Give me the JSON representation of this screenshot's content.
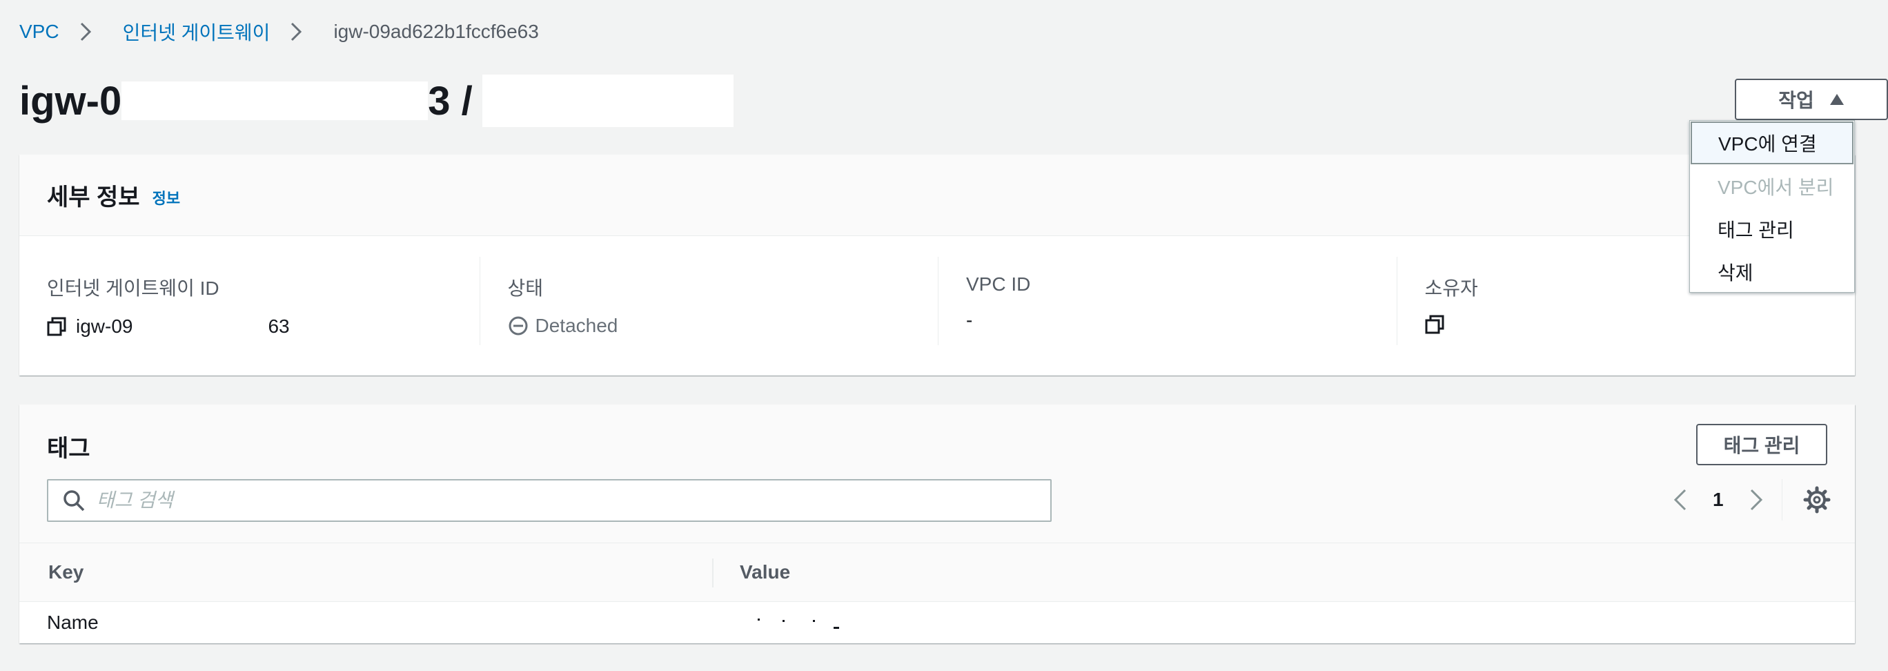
{
  "breadcrumb": {
    "items": [
      {
        "label": "VPC"
      },
      {
        "label": "인터넷 게이트웨이"
      },
      {
        "label": "igw-09ad622b1fccf6e63"
      }
    ]
  },
  "header": {
    "title_prefix": "igw-0",
    "title_suffix": "3 /",
    "actions_label": "작업"
  },
  "actions_menu": {
    "items": [
      {
        "label": "VPC에 연결",
        "state": "highlighted"
      },
      {
        "label": "VPC에서 분리",
        "state": "disabled"
      },
      {
        "label": "태그 관리",
        "state": "enabled"
      },
      {
        "label": "삭제",
        "state": "enabled"
      }
    ]
  },
  "details": {
    "title": "세부 정보",
    "info_link": "정보",
    "fields": [
      {
        "label": "인터넷 게이트웨이 ID",
        "value_prefix": "igw-09",
        "value_suffix": "63",
        "icon": "copy-icon"
      },
      {
        "label": "상태",
        "value": "Detached",
        "icon": "minus-circle-icon"
      },
      {
        "label": "VPC ID",
        "value": "-"
      },
      {
        "label": "소유자",
        "value": "",
        "icon": "copy-icon"
      }
    ]
  },
  "tags": {
    "title": "태그",
    "manage_label": "태그 관리",
    "search_placeholder": "태그 검색",
    "current_page": "1",
    "columns": {
      "key": "Key",
      "value": "Value"
    },
    "rows": [
      {
        "key": "Name",
        "value": ""
      }
    ]
  },
  "colors": {
    "link": "#0073bb",
    "background": "#f2f3f3",
    "text": "#16191f",
    "muted": "#545b64",
    "disabled": "#aab7b8"
  }
}
